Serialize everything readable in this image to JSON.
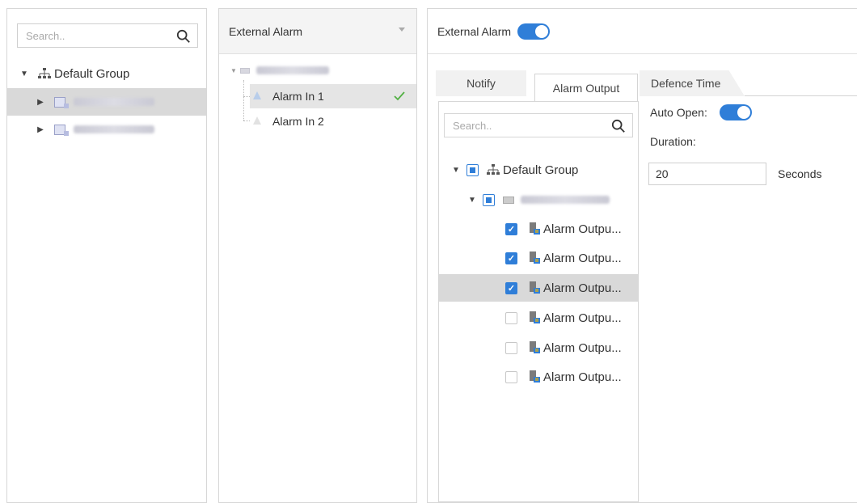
{
  "left_tree": {
    "search_placeholder": "Search..",
    "root_label": "Default Group"
  },
  "alarm_pane": {
    "header": "External Alarm",
    "inputs": [
      {
        "label": "Alarm In 1",
        "enabled": true
      },
      {
        "label": "Alarm In 2",
        "enabled": false
      }
    ]
  },
  "config": {
    "header_label": "External Alarm",
    "header_toggle_on": true,
    "tabs": [
      {
        "label": "Notify",
        "active": false
      },
      {
        "label": "Alarm Output",
        "active": true
      },
      {
        "label": "Defence Time",
        "active": false
      }
    ],
    "output_tree": {
      "search_placeholder": "Search..",
      "root_label": "Default Group",
      "outputs": [
        {
          "label": "Alarm Outpu...",
          "checked": true
        },
        {
          "label": "Alarm Outpu...",
          "checked": true
        },
        {
          "label": "Alarm Outpu...",
          "checked": true
        },
        {
          "label": "Alarm Outpu...",
          "checked": false
        },
        {
          "label": "Alarm Outpu...",
          "checked": false
        },
        {
          "label": "Alarm Outpu...",
          "checked": false
        }
      ]
    },
    "auto_open_label": "Auto Open:",
    "auto_open_on": true,
    "duration_label": "Duration:",
    "duration_value": "20",
    "duration_unit": "Seconds"
  },
  "colors": {
    "accent": "#2f7ed8",
    "selected_row": "#d9d9d9",
    "check_green": "#52b043"
  }
}
